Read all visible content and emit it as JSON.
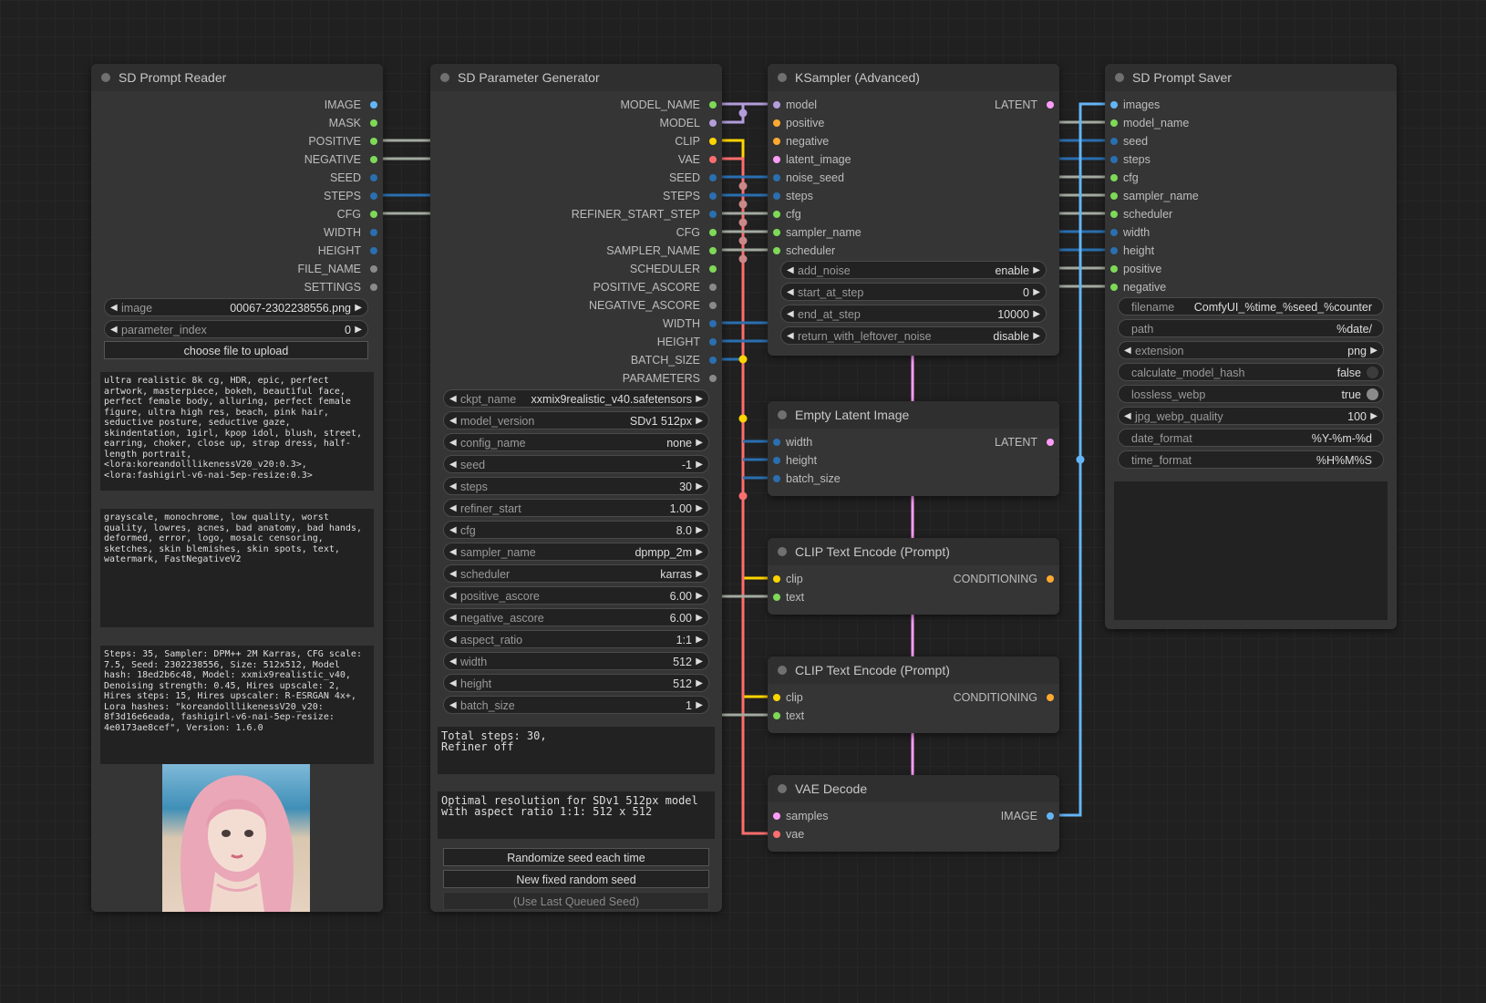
{
  "colors": {
    "model": "#b39ddb",
    "clip": "#ffd500",
    "vae": "#ff6e6e",
    "latent": "#ff9cf9",
    "conditioning": "#ffa931",
    "image": "#64b5f6",
    "int": "#2a6fb0",
    "float": "#7ed957",
    "string": "#a3aba0",
    "other": "#8a8a8a"
  },
  "reader": {
    "title": "SD Prompt Reader",
    "outputs": [
      {
        "label": "IMAGE",
        "type": "image"
      },
      {
        "label": "MASK",
        "type": "float"
      },
      {
        "label": "POSITIVE",
        "type": "float"
      },
      {
        "label": "NEGATIVE",
        "type": "float"
      },
      {
        "label": "SEED",
        "type": "int"
      },
      {
        "label": "STEPS",
        "type": "int"
      },
      {
        "label": "CFG",
        "type": "float"
      },
      {
        "label": "WIDTH",
        "type": "int"
      },
      {
        "label": "HEIGHT",
        "type": "int"
      },
      {
        "label": "FILE_NAME",
        "type": "other"
      },
      {
        "label": "SETTINGS",
        "type": "other"
      }
    ],
    "image_label": "image",
    "image_value": "00067-2302238556.png",
    "param_label": "parameter_index",
    "param_value": "0",
    "upload_label": "choose file to upload",
    "positive_text": "ultra realistic 8k cg, HDR, epic, perfect artwork, masterpiece, bokeh, beautiful face, perfect female body, alluring, perfect female figure, ultra high res, beach, pink hair, seductive posture, seductive gaze, skindentation, 1girl, kpop idol, blush, street, earring, choker, close up, strap dress, half-length portrait, <lora:koreandolllikenessV20_v20:0.3>, <lora:fashigirl-v6-nai-5ep-resize:0.3>",
    "negative_text": "grayscale, monochrome, low quality, worst quality, lowres, acnes, bad anatomy, bad hands, deformed, error, logo, mosaic censoring, sketches, skin blemishes, skin spots, text, watermark, FastNegativeV2",
    "settings_text": "Steps: 35, Sampler: DPM++ 2M Karras, CFG scale: 7.5, Seed: 2302238556, Size: 512x512, Model hash: 18ed2b6c48, Model: xxmix9realistic_v40, Denoising strength: 0.45, Hires upscale: 2, Hires steps: 15, Hires upscaler: R-ESRGAN 4x+, Lora hashes: \"koreandolllikenessV20_v20: 8f3d16e6eada, fashigirl-v6-nai-5ep-resize: 4e0173ae8cef\", Version: 1.6.0"
  },
  "generator": {
    "title": "SD Parameter Generator",
    "outputs": [
      {
        "label": "MODEL_NAME",
        "type": "float"
      },
      {
        "label": "MODEL",
        "type": "model"
      },
      {
        "label": "CLIP",
        "type": "clip"
      },
      {
        "label": "VAE",
        "type": "vae"
      },
      {
        "label": "SEED",
        "type": "int"
      },
      {
        "label": "STEPS",
        "type": "int"
      },
      {
        "label": "REFINER_START_STEP",
        "type": "int"
      },
      {
        "label": "CFG",
        "type": "float"
      },
      {
        "label": "SAMPLER_NAME",
        "type": "float"
      },
      {
        "label": "SCHEDULER",
        "type": "float"
      },
      {
        "label": "POSITIVE_ASCORE",
        "type": "other"
      },
      {
        "label": "NEGATIVE_ASCORE",
        "type": "other"
      },
      {
        "label": "WIDTH",
        "type": "int"
      },
      {
        "label": "HEIGHT",
        "type": "int"
      },
      {
        "label": "BATCH_SIZE",
        "type": "int"
      },
      {
        "label": "PARAMETERS",
        "type": "other"
      }
    ],
    "widgets": [
      {
        "label": "ckpt_name",
        "value": "xxmix9realistic_v40.safetensors"
      },
      {
        "label": "model_version",
        "value": "SDv1 512px"
      },
      {
        "label": "config_name",
        "value": "none"
      },
      {
        "label": "seed",
        "value": "-1"
      },
      {
        "label": "steps",
        "value": "30"
      },
      {
        "label": "refiner_start",
        "value": "1.00"
      },
      {
        "label": "cfg",
        "value": "8.0"
      },
      {
        "label": "sampler_name",
        "value": "dpmpp_2m"
      },
      {
        "label": "scheduler",
        "value": "karras"
      },
      {
        "label": "positive_ascore",
        "value": "6.00"
      },
      {
        "label": "negative_ascore",
        "value": "6.00"
      },
      {
        "label": "aspect_ratio",
        "value": "1:1"
      },
      {
        "label": "width",
        "value": "512"
      },
      {
        "label": "height",
        "value": "512"
      },
      {
        "label": "batch_size",
        "value": "1"
      }
    ],
    "steps_text": "Total steps: 30,\nRefiner off",
    "resolution_text": "Optimal resolution for SDv1 512px model\nwith aspect ratio 1:1: 512 x 512",
    "randomize_label": "Randomize seed each time",
    "new_seed_label": "New fixed random seed",
    "last_seed_label": "(Use Last Queued Seed)"
  },
  "ksampler": {
    "title": "KSampler (Advanced)",
    "inputs": [
      {
        "label": "model",
        "type": "model"
      },
      {
        "label": "positive",
        "type": "conditioning"
      },
      {
        "label": "negative",
        "type": "conditioning"
      },
      {
        "label": "latent_image",
        "type": "latent"
      },
      {
        "label": "noise_seed",
        "type": "int"
      },
      {
        "label": "steps",
        "type": "int"
      },
      {
        "label": "cfg",
        "type": "float"
      },
      {
        "label": "sampler_name",
        "type": "float"
      },
      {
        "label": "scheduler",
        "type": "float"
      }
    ],
    "output": {
      "label": "LATENT",
      "type": "latent"
    },
    "widgets": [
      {
        "label": "add_noise",
        "value": "enable"
      },
      {
        "label": "start_at_step",
        "value": "0"
      },
      {
        "label": "end_at_step",
        "value": "10000"
      },
      {
        "label": "return_with_leftover_noise",
        "value": "disable"
      }
    ]
  },
  "empty_latent": {
    "title": "Empty Latent Image",
    "inputs": [
      {
        "label": "width",
        "type": "int"
      },
      {
        "label": "height",
        "type": "int"
      },
      {
        "label": "batch_size",
        "type": "int"
      }
    ],
    "output": {
      "label": "LATENT",
      "type": "latent"
    }
  },
  "clip1": {
    "title": "CLIP Text Encode (Prompt)",
    "inputs": [
      {
        "label": "clip",
        "type": "clip"
      },
      {
        "label": "text",
        "type": "float"
      }
    ],
    "output": {
      "label": "CONDITIONING",
      "type": "conditioning"
    }
  },
  "clip2": {
    "title": "CLIP Text Encode (Prompt)",
    "inputs": [
      {
        "label": "clip",
        "type": "clip"
      },
      {
        "label": "text",
        "type": "float"
      }
    ],
    "output": {
      "label": "CONDITIONING",
      "type": "conditioning"
    }
  },
  "vae_decode": {
    "title": "VAE Decode",
    "inputs": [
      {
        "label": "samples",
        "type": "latent"
      },
      {
        "label": "vae",
        "type": "vae"
      }
    ],
    "output": {
      "label": "IMAGE",
      "type": "image"
    }
  },
  "saver": {
    "title": "SD Prompt Saver",
    "inputs": [
      {
        "label": "images",
        "type": "image"
      },
      {
        "label": "model_name",
        "type": "float"
      },
      {
        "label": "seed",
        "type": "int"
      },
      {
        "label": "steps",
        "type": "int"
      },
      {
        "label": "cfg",
        "type": "float"
      },
      {
        "label": "sampler_name",
        "type": "float"
      },
      {
        "label": "scheduler",
        "type": "float"
      },
      {
        "label": "width",
        "type": "int"
      },
      {
        "label": "height",
        "type": "int"
      },
      {
        "label": "positive",
        "type": "float"
      },
      {
        "label": "negative",
        "type": "float"
      }
    ],
    "widgets": [
      {
        "label": "filename",
        "value": "ComfyUI_%time_%seed_%counter",
        "kind": "text"
      },
      {
        "label": "path",
        "value": "%date/",
        "kind": "text"
      },
      {
        "label": "extension",
        "value": "png",
        "kind": "combo"
      },
      {
        "label": "calculate_model_hash",
        "value": "false",
        "kind": "toggle"
      },
      {
        "label": "lossless_webp",
        "value": "true",
        "kind": "toggle"
      },
      {
        "label": "jpg_webp_quality",
        "value": "100",
        "kind": "combo"
      },
      {
        "label": "date_format",
        "value": "%Y-%m-%d",
        "kind": "text"
      },
      {
        "label": "time_format",
        "value": "%H%M%S",
        "kind": "text"
      }
    ]
  }
}
